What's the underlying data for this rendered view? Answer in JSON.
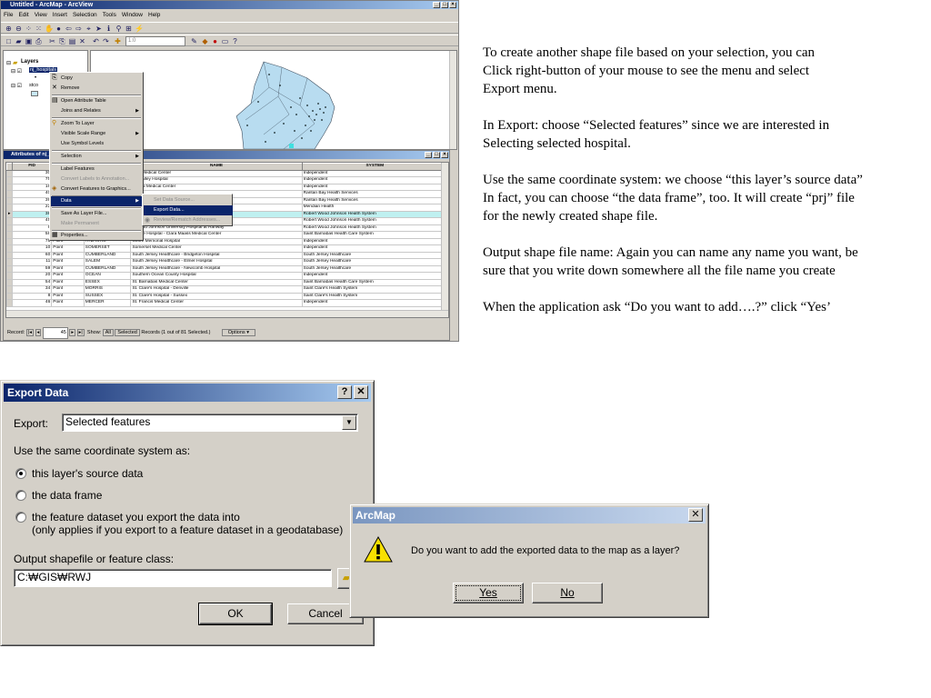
{
  "arcmap": {
    "title": "Untitled - ArcMap - ArcView",
    "menu": [
      "File",
      "Edit",
      "View",
      "Insert",
      "Selection",
      "Tools",
      "Window",
      "Help"
    ],
    "scale_value": "1:0",
    "toc": {
      "root": "Layers",
      "layer1": "nj_hospitals",
      "layer2": "stco"
    },
    "context_menu": {
      "items": [
        {
          "label": "Copy",
          "disabled": false
        },
        {
          "label": "Remove",
          "disabled": false
        },
        {
          "label": "Open Attribute Table",
          "disabled": false
        },
        {
          "label": "Joins and Relates",
          "disabled": false
        },
        {
          "label": "Zoom To Layer",
          "disabled": false
        },
        {
          "label": "Visible Scale Range",
          "disabled": false
        },
        {
          "label": "Use Symbol Levels",
          "disabled": false
        },
        {
          "label": "Selection",
          "disabled": false
        },
        {
          "label": "Label Features",
          "disabled": false
        },
        {
          "label": "Convert Labels to Annotation...",
          "disabled": true
        },
        {
          "label": "Convert Features to Graphics...",
          "disabled": false
        },
        {
          "label": "Data",
          "disabled": false
        },
        {
          "label": "Save As Layer File...",
          "disabled": false
        },
        {
          "label": "Make Permanent",
          "disabled": true
        },
        {
          "label": "Properties...",
          "disabled": false
        }
      ],
      "submenu": [
        {
          "label": "Set Data Source...",
          "disabled": true
        },
        {
          "label": "Export Data...",
          "disabled": false
        },
        {
          "label": "Review/Rematch Addresses...",
          "disabled": true
        }
      ]
    },
    "attributes": {
      "title": "Attributes of nj_hospitals",
      "columns": [
        "FID",
        "",
        "",
        "NAME",
        "SYSTEM"
      ],
      "rows": [
        [
          "30",
          "",
          "",
          "...es Medical Center",
          "Independent"
        ],
        [
          "75",
          "",
          "",
          "...k Valley Hospital",
          "Independent"
        ],
        [
          "16",
          "",
          "",
          "...ional Medical Center",
          "Independent"
        ],
        [
          "40",
          "",
          "",
          "",
          "Raritan Bay Health Services"
        ],
        [
          "39",
          "",
          "",
          "",
          "Raritan Bay Health Services"
        ],
        [
          "22",
          "",
          "",
          "",
          "Meridian Health"
        ],
        [
          "38",
          "",
          "",
          "",
          "Robert Wood Johnson Health System"
        ],
        [
          "45",
          "",
          "",
          "...on",
          "Robert Wood Johnson Health System"
        ],
        [
          "6",
          "",
          "",
          "...Wood Johnson University Hospital at Rahway",
          "Robert Wood Johnson Health System"
        ],
        [
          "58",
          "",
          "",
          "...Care Hospital - Clara Maass Medical Center",
          "Saint Barnabas Health Care System"
        ],
        [
          "78",
          "Point",
          "ATLANTIC",
          "Shore Memorial Hospital",
          "Independent"
        ],
        [
          "10",
          "Point",
          "SOMERSET",
          "Somerset Medical Center",
          "Independent"
        ],
        [
          "60",
          "Point",
          "CUMBERLAND",
          "South Jersey Healthcare - Bridgeton Hospital",
          "South Jersey Healthcare"
        ],
        [
          "11",
          "Point",
          "SALEM",
          "South Jersey Healthcare - Elmer Hospital",
          "South Jersey Healthcare"
        ],
        [
          "59",
          "Point",
          "CUMBERLAND",
          "South Jersey Healthcare - Newcomb Hospital",
          "South Jersey Healthcare"
        ],
        [
          "20",
          "Point",
          "OCEAN",
          "Southern Ocean County Hospital",
          "Independent"
        ],
        [
          "54",
          "Point",
          "ESSEX",
          "St. Barnabas Medical Center",
          "Saint Barnabas Health Care System"
        ],
        [
          "34",
          "Point",
          "MORRIS",
          "St. Clare's Hospital - Denville",
          "Saint Clare's Health System"
        ],
        [
          "8",
          "Point",
          "SUSSEX",
          "St. Clare's Hospital - Sussex",
          "Saint Clare's Health System"
        ],
        [
          "46",
          "Point",
          "MERCER",
          "St. Francis Medical Center",
          "Independent"
        ]
      ],
      "record_label": "Record:",
      "record_value": "45",
      "show_label": "Show:",
      "all_label": "All",
      "selected_label": "Selected",
      "records_text": "Records (1 out of 81 Selected.)",
      "options_label": "Options"
    }
  },
  "instructions": [
    "To create another shape file based on your selection, you can\nClick right-button of your mouse to see the menu and select\nExport menu.",
    "In Export:  choose “Selected features” since we are interested in\nSelecting selected hospital.",
    "Use the same coordinate system: we choose “this layer’s source data”\nIn fact, you can choose “the data frame”, too.  It will create “prj” file\nfor the newly created shape file.",
    "Output shape file name:  Again you can name any name you want, be\nsure that you write down somewhere all the file name you create",
    "When the application ask “Do you want to add….?” click “Yes’"
  ],
  "export_dialog": {
    "title": "Export Data",
    "help_btn": "?",
    "close_btn": "✕",
    "export_label": "Export:",
    "export_value": "Selected features",
    "coord_label": "Use the same coordinate system as:",
    "opt1": "this layer's source data",
    "opt2": "the data frame",
    "opt3_line1": "the feature dataset you export the data into",
    "opt3_line2": "(only applies if you export to a feature dataset in a geodatabase)",
    "output_label": "Output shapefile or feature class:",
    "output_value": "C:₩GIS₩RWJ",
    "ok": "OK",
    "cancel": "Cancel"
  },
  "confirm_dialog": {
    "title": "ArcMap",
    "close_btn": "✕",
    "message": "Do you want to add the exported data to the map as a layer?",
    "yes": "Yes",
    "no": "No"
  }
}
